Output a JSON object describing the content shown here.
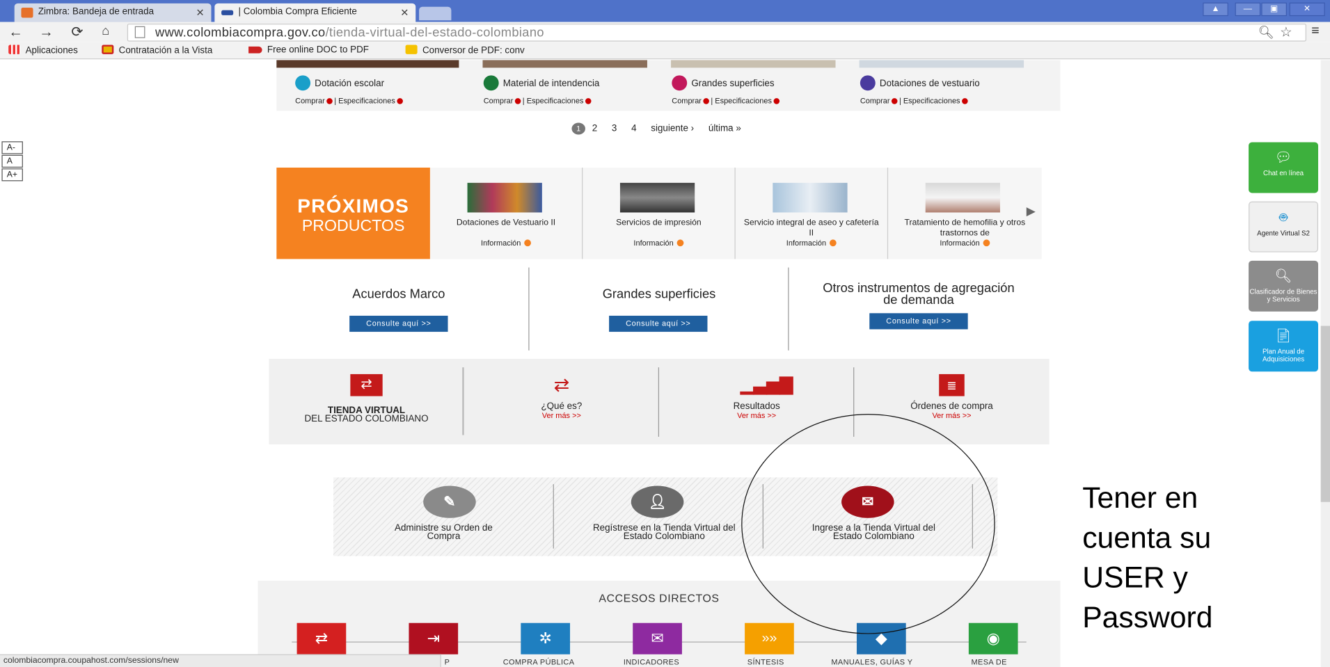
{
  "browser": {
    "tabs": [
      {
        "label": "Zimbra: Bandeja de entrada"
      },
      {
        "label": "| Colombia Compra Eficiente"
      }
    ],
    "url_domain": "www.colombiacompra.gov.co",
    "url_path": "/tienda-virtual-del-estado-colombiano",
    "bookmarks": [
      "Aplicaciones",
      "Contratación a la Vista",
      "Free online DOC to PDF",
      "Conversor de PDF: conv"
    ],
    "status_url": "colombiacompra.coupahost.com/sessions/new"
  },
  "font_controls": [
    "A-",
    "A",
    "A+"
  ],
  "products": [
    {
      "name": "Dotación escolar",
      "color": "#1a9fc9"
    },
    {
      "name": "Material de intendencia",
      "color": "#1a7a3a"
    },
    {
      "name": "Grandes superficies",
      "color": "#c2185b"
    },
    {
      "name": "Dotaciones de vestuario",
      "color": "#4a3b9e"
    }
  ],
  "product_links": {
    "buy": "Comprar",
    "specs": "| Especificaciones"
  },
  "pagination": {
    "current": "1",
    "pages": [
      "2",
      "3",
      "4"
    ],
    "next": "siguiente ›",
    "last": "última »"
  },
  "proximos": {
    "line1": "PRÓXIMOS",
    "line2": "PRODUCTOS",
    "info": "Información",
    "items": [
      "Dotaciones de Vestuario II",
      "Servicios de impresión",
      "Servicio integral de aseo y cafetería II",
      "Tratamiento de hemofilia y otros trastornos de"
    ]
  },
  "acuerdos": [
    {
      "title": "Acuerdos Marco",
      "button": "Consulte aquí >>"
    },
    {
      "title": "Grandes superficies",
      "button": "Consulte aquí >>"
    },
    {
      "title": "Otros instrumentos de agregación de demanda",
      "button": "Consulte aquí >>"
    }
  ],
  "tienda": {
    "title_bold": "TIENDA VIRTUAL",
    "title_rest": "DEL ESTADO COLOMBIANO",
    "items": [
      {
        "title": "¿Qué es?",
        "more": "Ver más >>"
      },
      {
        "title": "Resultados",
        "more": "Ver más >>"
      },
      {
        "title": "Órdenes de compra",
        "more": "Ver más >>"
      }
    ]
  },
  "actions": [
    "Administre su Orden de Compra",
    "Regístrese en la Tienda Virtual del Estado Colombiano",
    "Ingrese a la Tienda Virtual del Estado Colombiano"
  ],
  "accesos": {
    "title": "ACCESOS DIRECTOS",
    "labels": [
      "P",
      "COMPRA PÚBLICA",
      "INDICADORES",
      "SÍNTESIS",
      "MANUALES, GUÍAS Y",
      "MESA DE"
    ],
    "colors": [
      "#d42020",
      "#b01020",
      "#1f7fc0",
      "#8e2aa0",
      "#f5a000",
      "#1f6fb0",
      "#2aa040"
    ]
  },
  "widgets": [
    {
      "label": "Chat en línea",
      "color": "#3db03d"
    },
    {
      "label": "Agente Virtual S2",
      "color": "#f0f0f0"
    },
    {
      "label": "Clasificador de Bienes y Servicios",
      "color": "#8c8c8c"
    },
    {
      "label": "Plan Anual de Adquisiciones",
      "color": "#1aa0e0"
    }
  ],
  "note": "Tener en cuenta su USER y Password"
}
